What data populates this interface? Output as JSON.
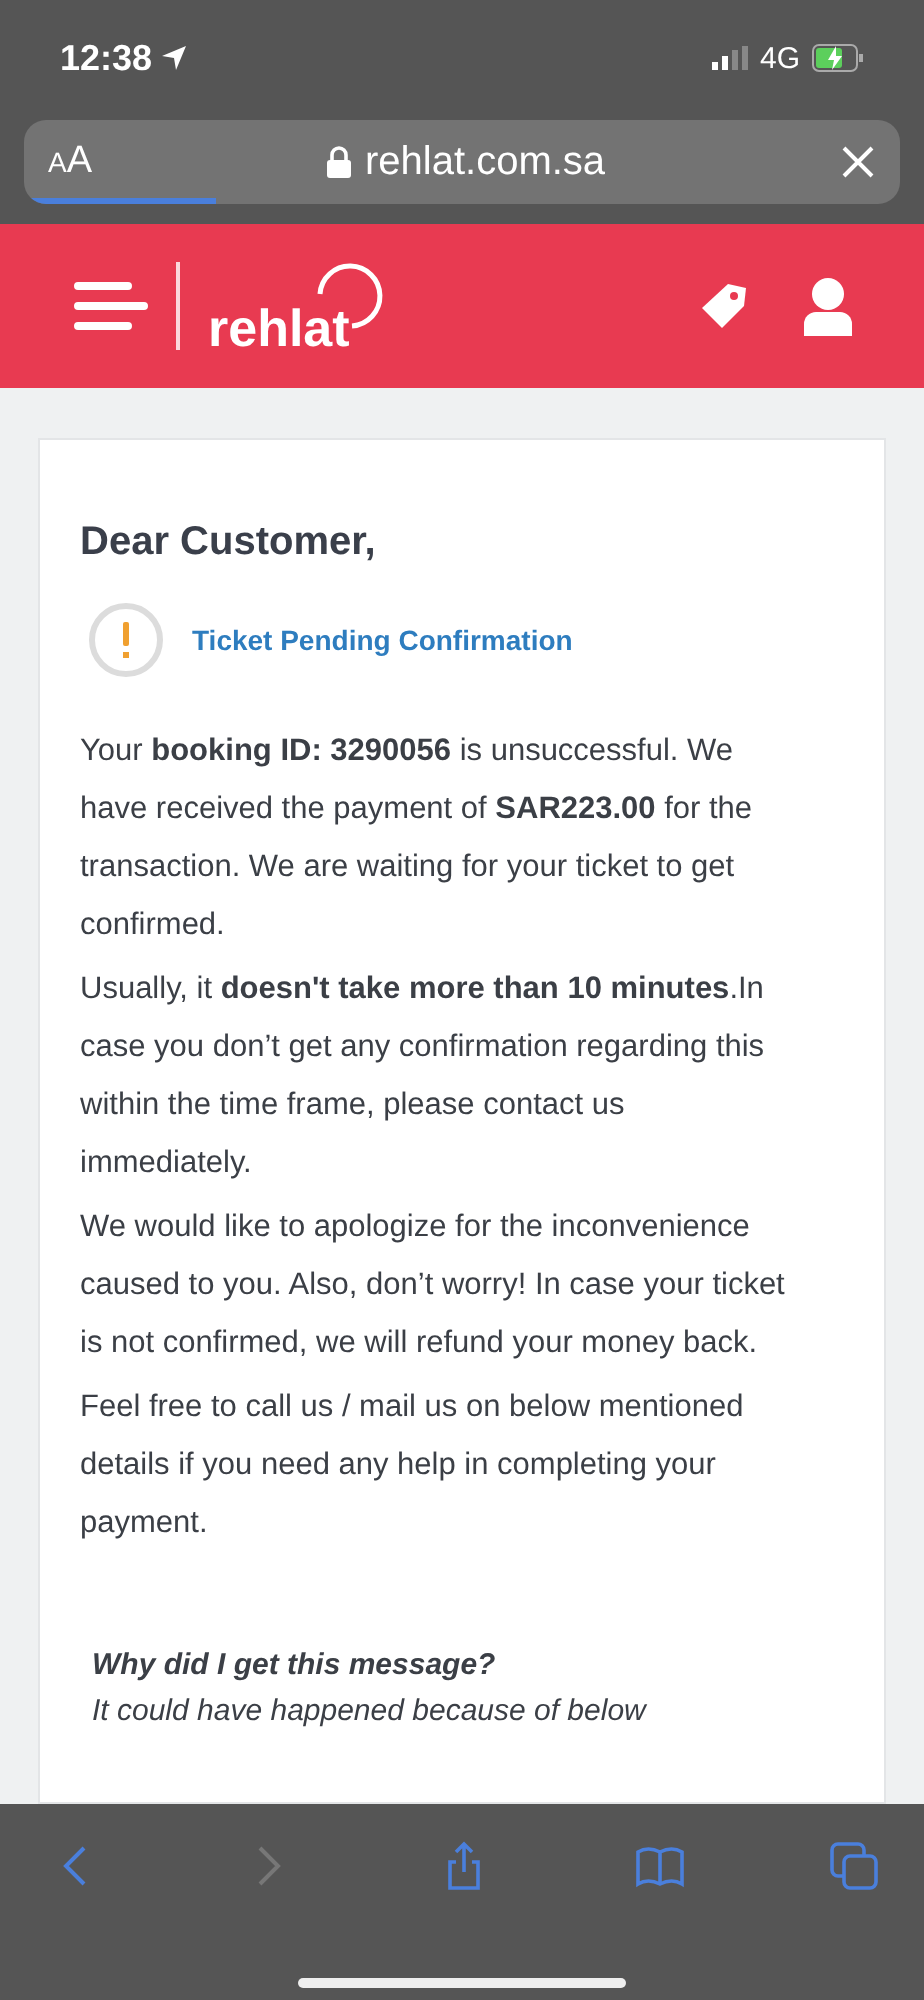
{
  "status_bar": {
    "time": "12:38",
    "network": "4G"
  },
  "browser": {
    "text_size_button": "AA",
    "url": "rehlat.com.sa",
    "load_progress": {
      "level": 0.22
    }
  },
  "header": {
    "logo": "rehlat"
  },
  "card": {
    "greeting": "Dear Customer,",
    "status": "Ticket Pending Confirmation",
    "paragraphs": [
      {
        "text": "Your **booking ID: 3290056** is unsuccessful. We have received the payment of **SAR223.00** for the transaction. We are waiting for your ticket to get confirmed."
      },
      {
        "text": "Usually, it **doesn't take more than 10 minutes**.In case you don’t get any confirmation regarding this within the time frame, please contact us immediately."
      },
      {
        "text": "We would like to apologize for the inconvenience caused to you. Also, don’t worry! In case your ticket is not confirmed, we will refund your money back."
      },
      {
        "text": "Feel free to call us / mail us on below mentioned details if you need any help in completing your payment."
      }
    ],
    "faq_question": "Why did I get this message?",
    "faq_answer": "It could have happened because of below"
  },
  "toolbar": [
    {
      "kind": "back",
      "disabled": false
    },
    {
      "kind": "forward",
      "disabled": true
    },
    {
      "kind": "share",
      "disabled": false
    },
    {
      "kind": "bookmarks",
      "disabled": false
    },
    {
      "kind": "tabs",
      "disabled": false
    }
  ]
}
